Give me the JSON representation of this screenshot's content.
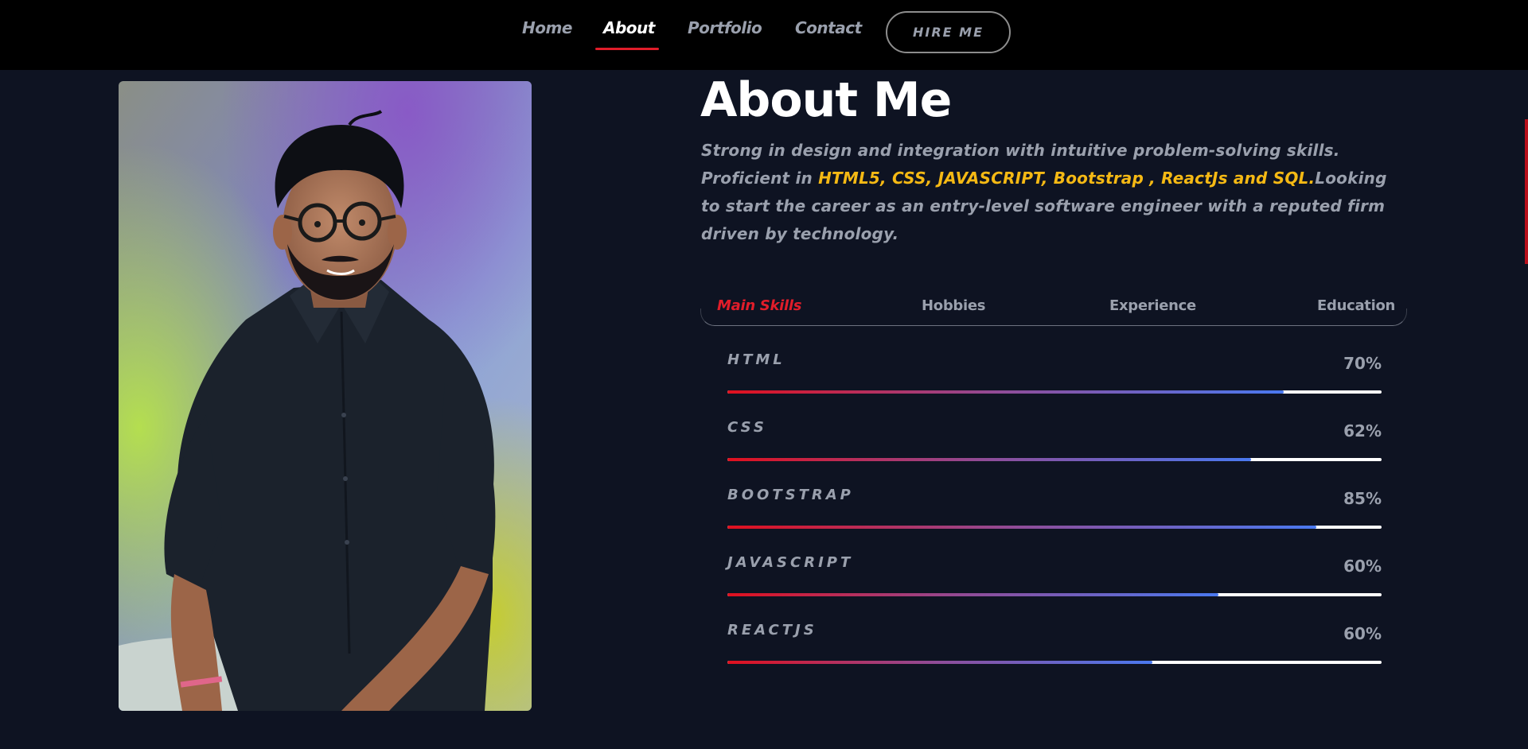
{
  "nav": {
    "links": [
      {
        "label": "Home",
        "active": false
      },
      {
        "label": "About",
        "active": true
      },
      {
        "label": "Portfolio",
        "active": false
      },
      {
        "label": "Contact",
        "active": false
      }
    ],
    "hire_label": "HIRE ME"
  },
  "about": {
    "title": "About Me",
    "desc_part1": "Strong in design and integration with intuitive problem-solving skills. Proficient in ",
    "desc_highlight": "HTML5, CSS, JAVASCRIPT, Bootstrap , ReactJs and SQL.",
    "desc_part2": "Looking to start the career as an entry-level software engineer with a reputed firm driven by technology."
  },
  "tabs": [
    {
      "label": "Main Skills",
      "active": true
    },
    {
      "label": "Hobbies",
      "active": false
    },
    {
      "label": "Experience",
      "active": false
    },
    {
      "label": "Education",
      "active": false
    }
  ],
  "skills": [
    {
      "name": "HTML",
      "percent_label": "70%",
      "fill_fraction": 0.85
    },
    {
      "name": "CSS",
      "percent_label": "62%",
      "fill_fraction": 0.8
    },
    {
      "name": "BOOTSTRAP",
      "percent_label": "85%",
      "fill_fraction": 0.9
    },
    {
      "name": "JAVASCRIPT",
      "percent_label": "60%",
      "fill_fraction": 0.75
    },
    {
      "name": "REACTJS",
      "percent_label": "60%",
      "fill_fraction": 0.65
    }
  ],
  "colors": {
    "background": "#0e1322",
    "navbar": "#000000",
    "accent_red": "#e11d2a",
    "highlight_yellow": "#f5b914",
    "muted_text": "#9aa0ad"
  },
  "photo": {
    "icon": "profile-photo"
  }
}
